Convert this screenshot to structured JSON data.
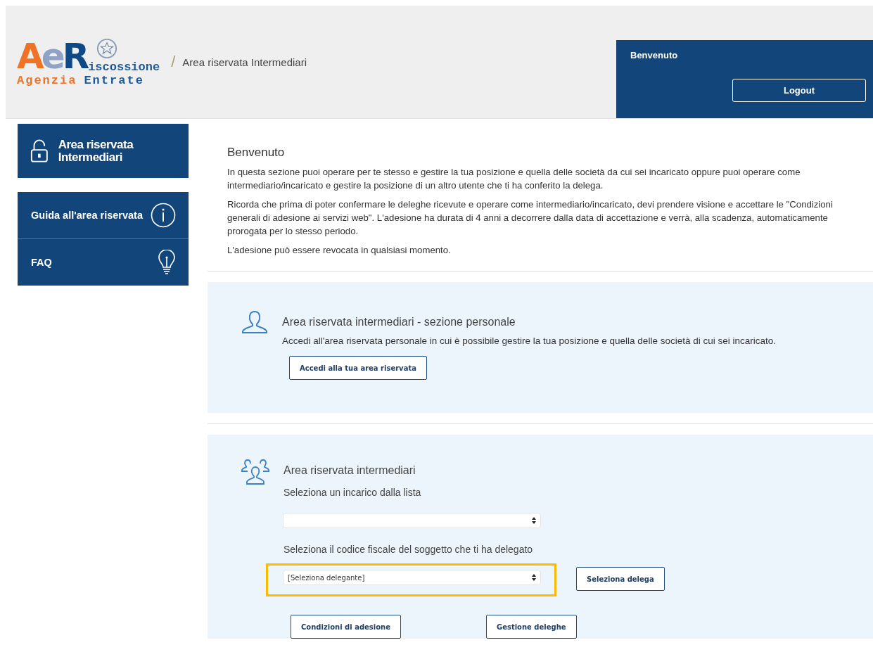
{
  "header": {
    "logo": {
      "mark": [
        "A",
        "e",
        "R"
      ],
      "word": "iscossione",
      "tagline": [
        "Agenzia",
        "Entrate"
      ]
    },
    "breadcrumb_separator": "/",
    "breadcrumb": "Area riservata Intermediari",
    "user_box": {
      "greeting": "Benvenuto",
      "logout": "Logout"
    }
  },
  "sidebar": {
    "title": "Area riservata Intermediari",
    "items": [
      {
        "label": "Guida all'area riservata",
        "kind": "info"
      },
      {
        "label": "FAQ",
        "kind": "bulb"
      }
    ]
  },
  "intro": {
    "title": "Benvenuto",
    "paragraphs": [
      "In questa sezione puoi operare per te stesso e gestire la tua posizione e quella delle società da cui sei incaricato oppure puoi operare come intermediario/incaricato e gestire la posizione di un altro utente che ti ha conferito la delega.",
      "Ricorda che prima di poter confermare le deleghe ricevute e operare come intermediario/incaricato, devi prendere visione e accettare le \"Condizioni generali di adesione ai servizi web\". L'adesione ha durata di 4 anni a decorrere dalla data di accettazione e verrà, alla scadenza, automaticamente prorogata per lo stesso periodo.",
      "L'adesione può essere revocata in qualsiasi momento."
    ]
  },
  "personal_section": {
    "title": "Area riservata intermediari - sezione personale",
    "description": "Accedi all'area riservata personale in cui è possibile gestire la tua posizione e quella delle società di cui sei incaricato.",
    "button": "Accedi alla tua area riservata"
  },
  "intermediary_section": {
    "title": "Area riservata intermediari",
    "fields": [
      {
        "label": "Seleziona un incarico dalla lista",
        "highlighted": false
      },
      {
        "label": "Seleziona il codice fiscale del soggetto che ti ha delegato",
        "value": "[Seleziona delegante]",
        "highlighted": true
      }
    ],
    "select_button": "Seleziona delega",
    "buttons": [
      "Condizioni di adesione",
      "Gestione deleghe"
    ]
  }
}
